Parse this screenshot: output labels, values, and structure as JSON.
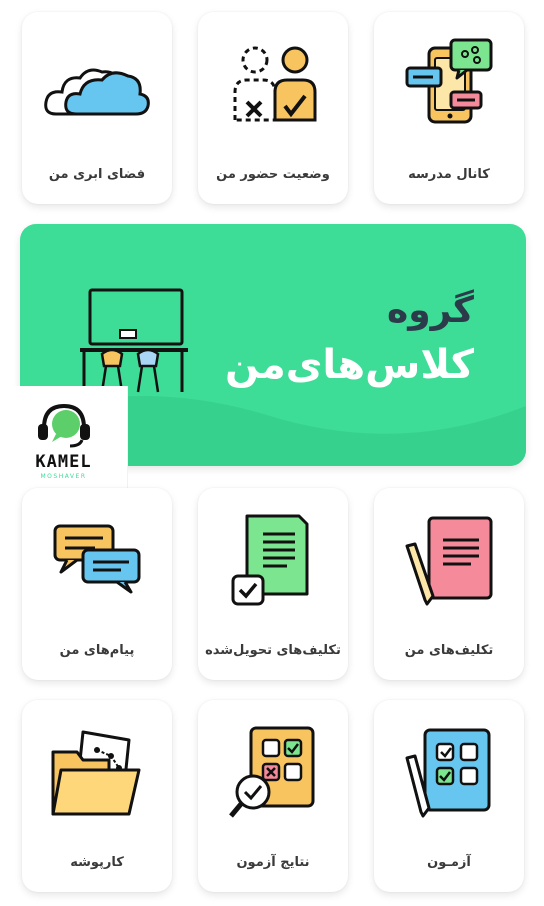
{
  "tiles": {
    "school_channel": "کانال مدرسه",
    "attendance": "وضعیت حضور من",
    "cloud": "فضای ابری من",
    "my_assignments": "تکلیف‌های من",
    "submitted_assignments": "تکلیف‌های تحویل‌شده",
    "my_messages": "پیام‌های من",
    "exam": "آزمـون",
    "exam_results": "نتایج آزمون",
    "portfolio": "کارپوشه"
  },
  "banner": {
    "line1": "گروه",
    "line2": "کلاس‌های‌من"
  },
  "logo": {
    "brand": "KAMEL",
    "sub": "MOSHAVER"
  },
  "colors": {
    "accent_green": "#3ddc97",
    "dark_text": "#2b3b4a"
  }
}
